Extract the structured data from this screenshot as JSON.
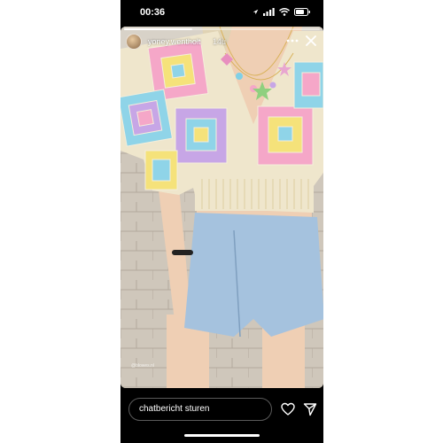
{
  "status_bar": {
    "time": "00:36",
    "icons": [
      "location-arrow-icon",
      "signal-icon",
      "wifi-icon",
      "battery-icon"
    ]
  },
  "story": {
    "username": "yoney.wentholt",
    "time_ago": "14u",
    "progress": 0.35,
    "watermark": "@blowes.nl",
    "icons": [
      "more-icon",
      "close-icon"
    ]
  },
  "reply": {
    "placeholder": "chatbericht sturen",
    "icons": [
      "heart-icon",
      "send-icon"
    ]
  },
  "colors": {
    "background": "#000000",
    "text": "#ffffff",
    "input_border": "#5a5a5a"
  }
}
